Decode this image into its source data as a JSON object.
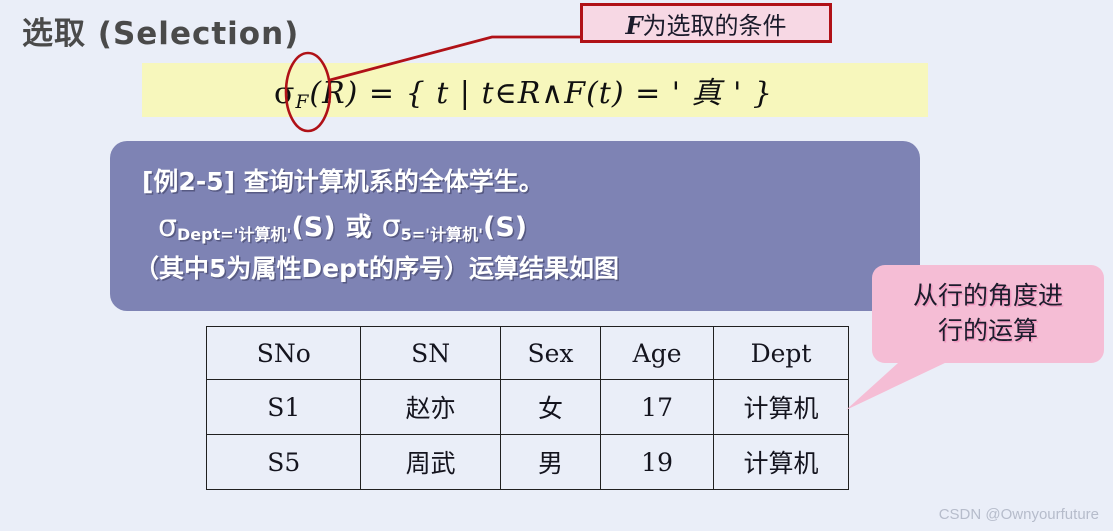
{
  "slide": {
    "background_color": "#eaeef8",
    "title": "选取 (Selection)"
  },
  "formula": {
    "band_color": "#f7f7bc",
    "sigma": "σ",
    "subscript": "F",
    "body": "(R) = { t  |   t∈R∧F(t) = ' 真 ' }",
    "full_text": "σF(R) = { t | t∈R∧F(t) = ' 真 ' }"
  },
  "annotation": {
    "condition_label_bold": "F",
    "condition_label_rest": "为选取的条件",
    "condition_label_full": "F为选取的条件",
    "border_color": "#b01117",
    "fill_color": "#f7d8e4",
    "leader_line_color": "#b01117",
    "ellipse_color": "#b01117"
  },
  "example": {
    "box_color": "#7e83b4",
    "line1": "[例2-5]  查询计算机系的全体学生。",
    "line2": {
      "sigma1": "σ",
      "sub1": "Dept='计算机'",
      "rel1": "(S)",
      "or": "或",
      "sigma2": "σ",
      "sub2": "5='计算机'",
      "rel2": "(S)",
      "full": "σ Dept='计算机'(S)  或  σ 5='计算机' (S)"
    },
    "line3": "（其中5为属性Dept的序号）运算结果如图"
  },
  "callout": {
    "fill_color": "#f5bdd5",
    "line1": "从行的角度进",
    "line2": "行的运算",
    "full_text": "从行的角度进行的运算"
  },
  "table": {
    "headers": [
      "SNo",
      "SN",
      "Sex",
      "Age",
      "Dept"
    ],
    "rows": [
      [
        "S1",
        "赵亦",
        "女",
        "17",
        "计算机"
      ],
      [
        "S5",
        "周武",
        "男",
        "19",
        "计算机"
      ]
    ]
  },
  "watermark": {
    "text": "CSDN @Ownyourfuture"
  }
}
